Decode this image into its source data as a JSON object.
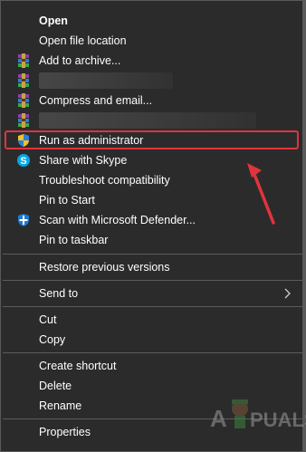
{
  "menu": {
    "items": [
      {
        "label": "Open",
        "icon": "none",
        "bold": true
      },
      {
        "label": "Open file location",
        "icon": "none"
      },
      {
        "label": "Add to archive...",
        "icon": "winrar-icon"
      },
      {
        "label": "",
        "icon": "winrar-icon",
        "obscured": true
      },
      {
        "label": "Compress and email...",
        "icon": "winrar-icon"
      },
      {
        "label": "",
        "icon": "winrar-icon",
        "obscured": true
      },
      {
        "label": "Run as administrator",
        "icon": "uac-shield-icon",
        "highlighted": true
      },
      {
        "label": "Share with Skype",
        "icon": "skype-icon"
      },
      {
        "label": "Troubleshoot compatibility",
        "icon": "none"
      },
      {
        "label": "Pin to Start",
        "icon": "none"
      },
      {
        "label": "Scan with Microsoft Defender...",
        "icon": "defender-icon"
      },
      {
        "label": "Pin to taskbar",
        "icon": "none"
      },
      {
        "label": "Restore previous versions",
        "icon": "none"
      },
      {
        "label": "Send to",
        "icon": "none",
        "submenu": true
      },
      {
        "label": "Cut",
        "icon": "none"
      },
      {
        "label": "Copy",
        "icon": "none"
      },
      {
        "label": "Create shortcut",
        "icon": "none"
      },
      {
        "label": "Delete",
        "icon": "none"
      },
      {
        "label": "Rename",
        "icon": "none"
      },
      {
        "label": "Properties",
        "icon": "none"
      }
    ]
  },
  "annotation": {
    "highlight_color": "#e0343d",
    "arrow_color": "#e0343d"
  },
  "watermark": {
    "text_left": "A",
    "text_right": "PUALS"
  },
  "colors": {
    "menu_bg": "#2b2b2b",
    "text": "#ffffff",
    "separator": "#5c5c5c"
  }
}
